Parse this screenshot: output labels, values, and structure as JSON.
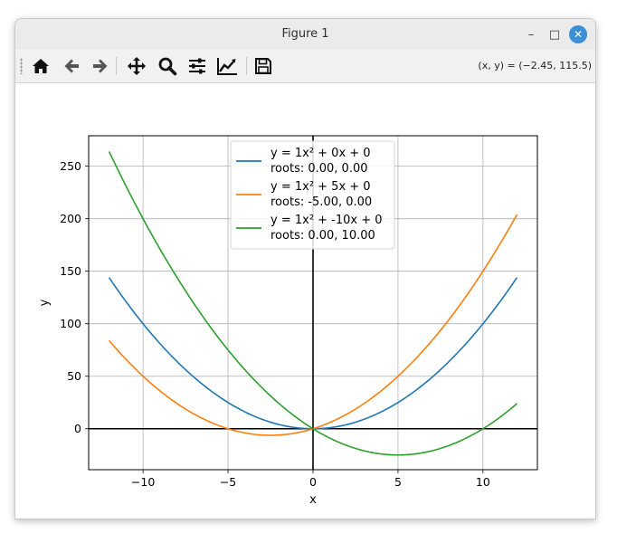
{
  "window": {
    "title": "Figure 1",
    "minimize_glyph": "–",
    "maximize_glyph": "□",
    "close_glyph": "✕"
  },
  "toolbar": {
    "buttons": [
      {
        "name": "home-icon"
      },
      {
        "name": "back-arrow-icon"
      },
      {
        "name": "forward-arrow-icon"
      },
      {
        "name": "pan-move-icon"
      },
      {
        "name": "zoom-magnifier-icon"
      },
      {
        "name": "configure-subplots-icon"
      },
      {
        "name": "edit-axis-curves-icon"
      },
      {
        "name": "save-floppy-icon"
      }
    ],
    "coordinates": "(x, y) = (−2.45, 115.5)"
  },
  "chart_data": {
    "type": "line",
    "xlabel": "x",
    "ylabel": "y",
    "xlim": [
      -13.2,
      13.2
    ],
    "ylim": [
      -39,
      279
    ],
    "xticks": [
      {
        "value": -10,
        "label": "−10"
      },
      {
        "value": -5,
        "label": "−5"
      },
      {
        "value": 0,
        "label": "0"
      },
      {
        "value": 5,
        "label": "5"
      },
      {
        "value": 10,
        "label": "10"
      }
    ],
    "yticks": [
      {
        "value": 0,
        "label": "0"
      },
      {
        "value": 50,
        "label": "50"
      },
      {
        "value": 100,
        "label": "100"
      },
      {
        "value": 150,
        "label": "150"
      },
      {
        "value": 200,
        "label": "200"
      },
      {
        "value": 250,
        "label": "250"
      }
    ],
    "grid": true,
    "legend_position": "top-center",
    "x_range": [
      -12,
      12
    ],
    "series": [
      {
        "label_line1": "y = 1x² + 0x + 0",
        "label_line2": "roots: 0.00, 0.00",
        "a": 1,
        "b": 0,
        "c": 0,
        "color": "#1f77b4"
      },
      {
        "label_line1": "y = 1x² + 5x + 0",
        "label_line2": "roots: -5.00, 0.00",
        "a": 1,
        "b": 5,
        "c": 0,
        "color": "#ff7f0e"
      },
      {
        "label_line1": "y = 1x² + -10x + 0",
        "label_line2": "roots: 0.00, 10.00",
        "a": 1,
        "b": -10,
        "c": 0,
        "color": "#2ca02c"
      }
    ]
  }
}
